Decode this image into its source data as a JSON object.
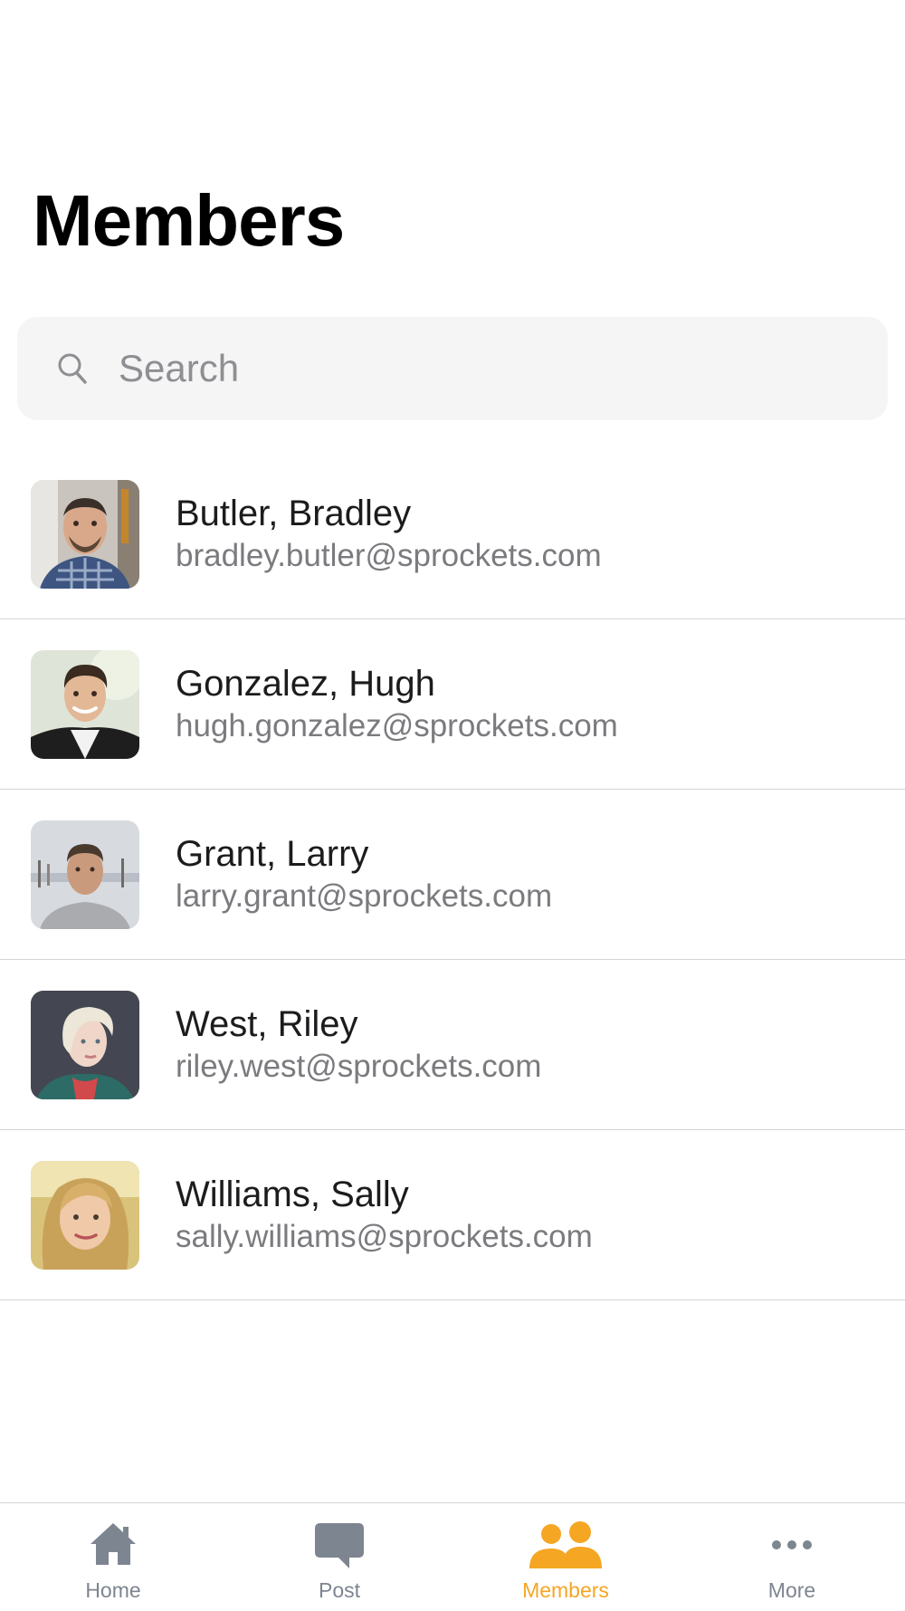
{
  "header": {
    "title": "Members"
  },
  "search": {
    "placeholder": "Search",
    "value": "",
    "icon": "search-icon"
  },
  "members": [
    {
      "name": "Butler, Bradley",
      "email": "bradley.butler@sprockets.com"
    },
    {
      "name": "Gonzalez, Hugh",
      "email": "hugh.gonzalez@sprockets.com"
    },
    {
      "name": "Grant, Larry",
      "email": "larry.grant@sprockets.com"
    },
    {
      "name": "West, Riley",
      "email": "riley.west@sprockets.com"
    },
    {
      "name": "Williams, Sally",
      "email": "sally.williams@sprockets.com"
    }
  ],
  "tabbar": {
    "tabs": [
      {
        "label": "Home",
        "icon": "home-icon",
        "active": false
      },
      {
        "label": "Post",
        "icon": "chat-bubble-icon",
        "active": false
      },
      {
        "label": "Members",
        "icon": "people-icon",
        "active": true
      },
      {
        "label": "More",
        "icon": "more-dots-icon",
        "active": false
      }
    ]
  },
  "colors": {
    "accent": "#f5a623",
    "inactive_tab": "#7d8590",
    "search_background": "#f5f5f5",
    "divider": "#d4d4d6"
  }
}
